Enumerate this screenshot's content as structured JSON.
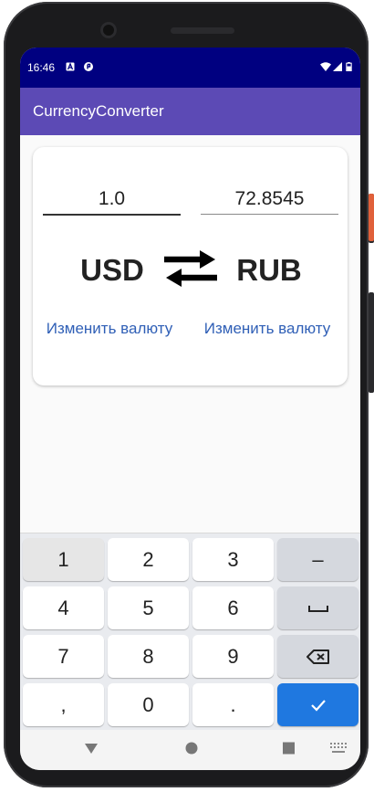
{
  "status_bar": {
    "time": "16:46"
  },
  "app_bar": {
    "title": "CurrencyConverter"
  },
  "converter": {
    "from": {
      "amount": "1.0",
      "currency": "USD",
      "change_label": "Изменить валюту"
    },
    "to": {
      "amount": "72.8545",
      "currency": "RUB",
      "change_label": "Изменить валюту"
    },
    "swap_icon": "swap-arrows-icon"
  },
  "keyboard": {
    "rows": [
      [
        "1",
        "2",
        "3",
        "–"
      ],
      [
        "4",
        "5",
        "6",
        "space"
      ],
      [
        "7",
        "8",
        "9",
        "backspace"
      ],
      [
        ",",
        "0",
        ".",
        "done"
      ]
    ],
    "keys": {
      "k1": "1",
      "k2": "2",
      "k3": "3",
      "minus": "–",
      "k4": "4",
      "k5": "5",
      "k6": "6",
      "k7": "7",
      "k8": "8",
      "k9": "9",
      "comma": ",",
      "k0": "0",
      "period": "."
    }
  },
  "colors": {
    "status_bar": "#000080",
    "app_bar": "#5c4ab5",
    "link": "#2f5fb6",
    "enter_key": "#1f78e0"
  }
}
